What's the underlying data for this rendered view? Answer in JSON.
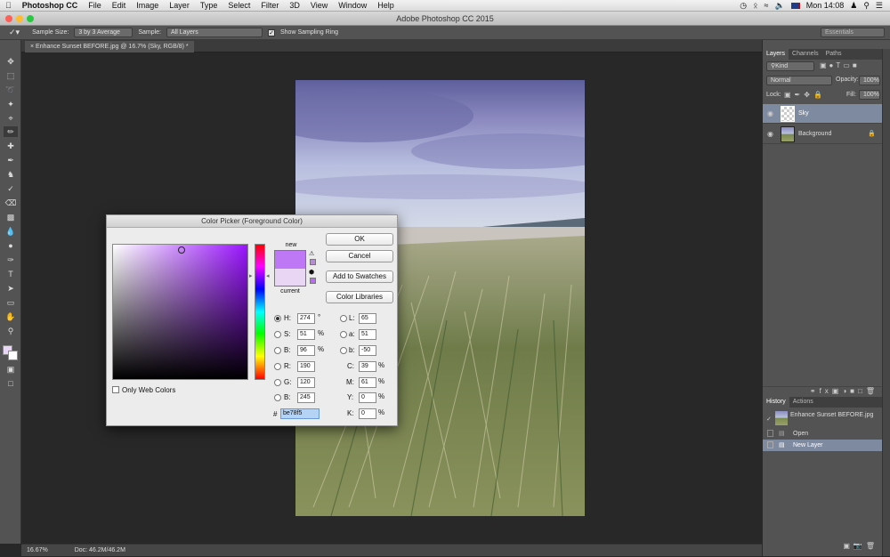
{
  "menubar": {
    "app_name": "Photoshop CC",
    "items": [
      "File",
      "Edit",
      "Image",
      "Layer",
      "Type",
      "Select",
      "Filter",
      "3D",
      "View",
      "Window",
      "Help"
    ],
    "clock": "Mon 14:08"
  },
  "window": {
    "title": "Adobe Photoshop CC 2015"
  },
  "options_bar": {
    "sample_size_label": "Sample Size:",
    "sample_size_value": "3 by 3 Average",
    "sample_label": "Sample:",
    "sample_value": "All Layers",
    "show_ring_label": "Show Sampling Ring",
    "workspace": "Essentials"
  },
  "document": {
    "tab_label": "Enhance Sunset BEFORE.jpg @ 16.7% (Sky, RGB/8) *",
    "zoom": "16.67%",
    "doc_size": "Doc: 46.2M/46.2M"
  },
  "layers_panel": {
    "tabs": [
      "Layers",
      "Channels",
      "Paths"
    ],
    "kind": "Kind",
    "blend_mode": "Normal",
    "opacity_label": "Opacity:",
    "opacity": "100%",
    "lock_label": "Lock:",
    "fill_label": "Fill:",
    "fill": "100%",
    "layers": [
      {
        "name": "Sky",
        "selected": true
      },
      {
        "name": "Background",
        "selected": false
      }
    ]
  },
  "history_panel": {
    "tabs": [
      "History",
      "Actions"
    ],
    "snapshot": "Enhance Sunset BEFORE.jpg",
    "items": [
      "Open",
      "New Layer"
    ]
  },
  "color_picker": {
    "title": "Color Picker (Foreground Color)",
    "new_label": "new",
    "current_label": "current",
    "new_color": "#be78f5",
    "current_color": "#e9d6f5",
    "hue_color": "#9a14ff",
    "buttons": {
      "ok": "OK",
      "cancel": "Cancel",
      "add_swatches": "Add to Swatches",
      "libraries": "Color Libraries"
    },
    "only_web_label": "Only Web Colors",
    "fields": {
      "H": "274",
      "S": "51",
      "B": "96",
      "R": "190",
      "G": "120",
      "Bb": "245",
      "L": "65",
      "a": "51",
      "b": "-50",
      "C": "39",
      "M": "61",
      "Y": "0",
      "K": "0"
    },
    "labels": {
      "H": "H:",
      "S": "S:",
      "B": "B:",
      "R": "R:",
      "G": "G:",
      "Bb": "B:",
      "L": "L:",
      "a": "a:",
      "b": "b:",
      "C": "C:",
      "M": "M:",
      "Y": "Y:",
      "K": "K:"
    },
    "units": {
      "deg": "°",
      "pct": "%"
    },
    "hex_label": "#",
    "hex": "be78f5"
  }
}
